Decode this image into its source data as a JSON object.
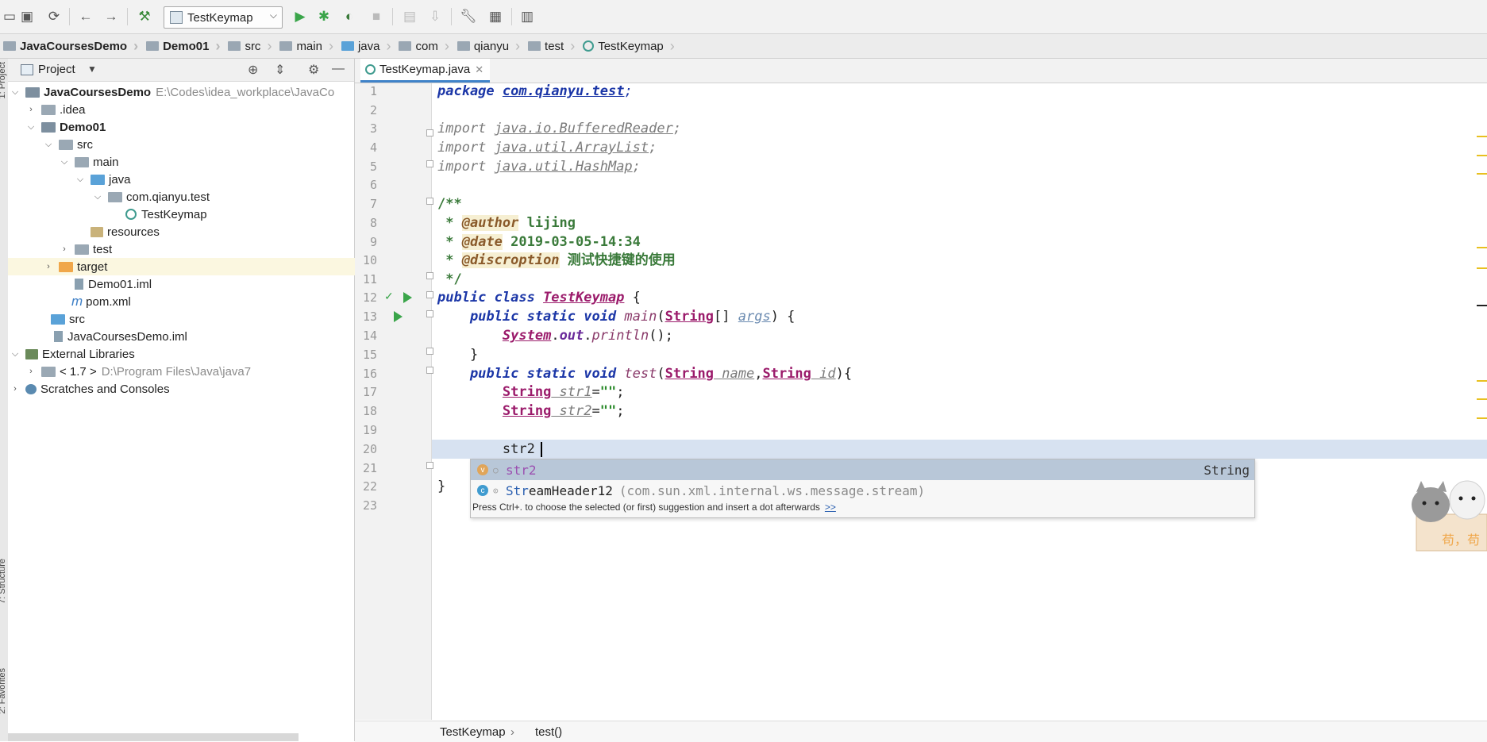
{
  "toolbar": {
    "run_config": "TestKeymap"
  },
  "breadcrumb": [
    "JavaCoursesDemo",
    "Demo01",
    "src",
    "main",
    "java",
    "com",
    "qianyu",
    "test",
    "TestKeymap"
  ],
  "side_tabs": {
    "project": "1: Project",
    "structure": "7: Structure",
    "favorites": "2: Favorites"
  },
  "project_panel": {
    "title": "Project",
    "tree": [
      {
        "label": "JavaCoursesDemo",
        "path": "E:\\Codes\\idea_workplace\\JavaCo",
        "bold": true
      },
      {
        "label": ".idea"
      },
      {
        "label": "Demo01",
        "bold": true
      },
      {
        "label": "src"
      },
      {
        "label": "main"
      },
      {
        "label": "java"
      },
      {
        "label": "com.qianyu.test"
      },
      {
        "label": "TestKeymap"
      },
      {
        "label": "resources"
      },
      {
        "label": "test"
      },
      {
        "label": "target"
      },
      {
        "label": "Demo01.iml"
      },
      {
        "label": "pom.xml"
      },
      {
        "label": "src"
      },
      {
        "label": "JavaCoursesDemo.iml"
      },
      {
        "label": "External Libraries"
      },
      {
        "label": "< 1.7 >",
        "path": "D:\\Program Files\\Java\\java7"
      },
      {
        "label": "Scratches and Consoles"
      }
    ]
  },
  "editor": {
    "tab_label": "TestKeymap.java",
    "line_numbers": [
      "1",
      "2",
      "3",
      "4",
      "5",
      "6",
      "7",
      "8",
      "9",
      "10",
      "11",
      "12",
      "13",
      "14",
      "15",
      "16",
      "17",
      "18",
      "19",
      "20",
      "21",
      "22",
      "23"
    ],
    "code": {
      "l1_kw": "package",
      "l1_pkg": "com.qianyu.test",
      "l1_end": ";",
      "l3_kw": "import",
      "l3_pkg": "java.io.BufferedReader",
      "l3_end": ";",
      "l4_kw": "import",
      "l4_pkg": "java.util.ArrayList",
      "l4_end": ";",
      "l5_kw": "import",
      "l5_pkg": "java.util.HashMap",
      "l5_end": ";",
      "l7": "/**",
      "l8_star": " * ",
      "l8_tag": "@author",
      "l8_val": " lijing",
      "l9_star": " * ",
      "l9_tag": "@date",
      "l9_val": " 2019-03-05-14:34",
      "l10_star": " * ",
      "l10_tag": "@discroption",
      "l10_val": " 测试快捷键的使用",
      "l11": " */",
      "l12_kw": "public class ",
      "l12_cls": "TestKeymap",
      "l12_end": " {",
      "l13_kw": "    public static void ",
      "l13_m": "main",
      "l13_p": "(",
      "l13_t": "String",
      "l13_b": "[] ",
      "l13_a": "args",
      "l13_end": ") {",
      "l14_ind": "        ",
      "l14_sys": "System",
      "l14_dot": ".",
      "l14_out": "out",
      "l14_dot2": ".",
      "l14_m": "println",
      "l14_end": "();",
      "l15": "    }",
      "l16_kw": "    public static void ",
      "l16_m": "test",
      "l16_p": "(",
      "l16_t1": "String",
      "l16_n1": " name",
      "l16_c": ",",
      "l16_t2": "String",
      "l16_n2": " id",
      "l16_end": "){",
      "l17_ind": "        ",
      "l17_t": "String",
      "l17_v": " str1",
      "l17_eq": "=",
      "l17_s": "\"\"",
      "l17_end": ";",
      "l18_ind": "        ",
      "l18_t": "String",
      "l18_v": " str2",
      "l18_eq": "=",
      "l18_s": "\"\"",
      "l18_end": ";",
      "l20": "        str2",
      "l21": "    }",
      "l22": "}"
    }
  },
  "autocomplete": {
    "items": [
      {
        "icon": "v",
        "name": "str2",
        "type": "String"
      },
      {
        "icon": "c",
        "name": "StreamHeader12",
        "detail": "(com.sun.xml.internal.ws.message.stream)"
      }
    ],
    "hint": "Press Ctrl+. to choose the selected (or first) suggestion and insert a dot afterwards",
    "hint_link": ">>"
  },
  "status_breadcrumb": {
    "class": "TestKeymap",
    "sep": "›",
    "method": "test()"
  },
  "sticker": {
    "caption": "苟，苟"
  }
}
